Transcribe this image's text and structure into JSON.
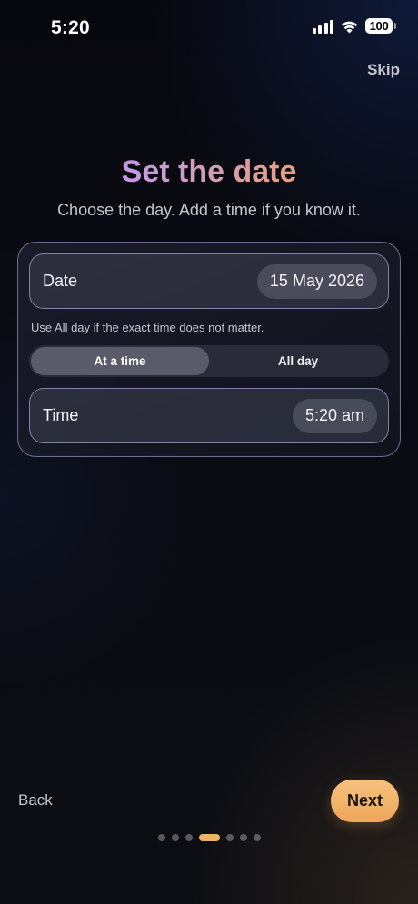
{
  "status_bar": {
    "time": "5:20",
    "battery": "100"
  },
  "header": {
    "skip_label": "Skip"
  },
  "title": "Set the date",
  "subtitle": "Choose the day. Add a time if you know it.",
  "form": {
    "date_label": "Date",
    "date_value": "15 May 2026",
    "hint": "Use All day if the exact time does not matter.",
    "segments": [
      {
        "label": "At a time",
        "selected": true
      },
      {
        "label": "All day",
        "selected": false
      }
    ],
    "time_label": "Time",
    "time_value": "5:20 am"
  },
  "footer": {
    "back_label": "Back",
    "next_label": "Next"
  },
  "pager": {
    "total": 7,
    "current": 4
  },
  "colors": {
    "accent_orange": "#f0b264",
    "title_gradient_start": "#b08cff",
    "title_gradient_end": "#f0b074"
  }
}
